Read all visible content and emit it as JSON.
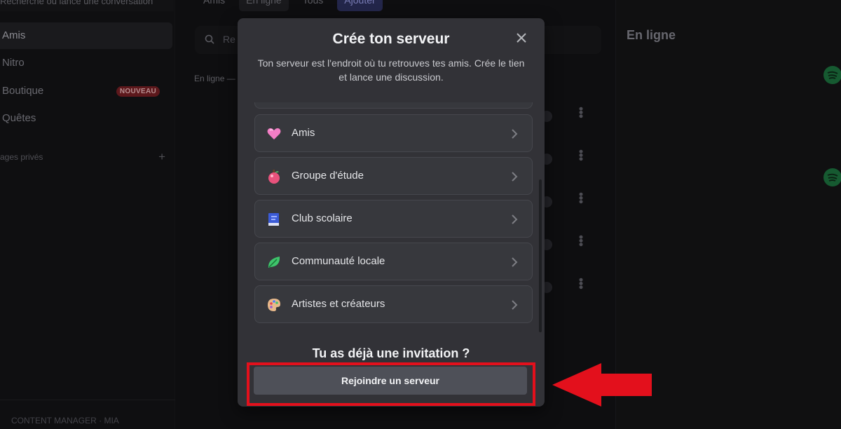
{
  "background": {
    "sidebar": {
      "search_text": "Recherche ou lance une conversation",
      "items": [
        {
          "label": "Amis",
          "active": true
        },
        {
          "label": "Nitro"
        },
        {
          "label": "Boutique",
          "badge": "NOUVEAU"
        },
        {
          "label": "Quêtes"
        }
      ],
      "dm_header": "ages privés",
      "dm_add": "+",
      "footer_text": "CONTENT MANAGER · MIA"
    },
    "tabs": [
      {
        "label": "Amis"
      },
      {
        "label": "En ligne",
        "selected": true
      },
      {
        "label": "Tous"
      },
      {
        "label": "Ajouter",
        "accent": true
      }
    ],
    "search_placeholder": "Re",
    "online_label": "En ligne —",
    "right_panel_title": "En ligne"
  },
  "modal": {
    "title": "Crée ton serveur",
    "subtitle": "Ton serveur est l'endroit où tu retrouves tes amis. Crée le tien et lance une discussion.",
    "options": [
      {
        "label": "Amis",
        "icon": "heart-icon"
      },
      {
        "label": "Groupe d'étude",
        "icon": "apple-icon"
      },
      {
        "label": "Club scolaire",
        "icon": "book-icon"
      },
      {
        "label": "Communauté locale",
        "icon": "leaf-icon"
      },
      {
        "label": "Artistes et créateurs",
        "icon": "palette-icon"
      }
    ],
    "invite_heading": "Tu as déjà une invitation ?",
    "join_button": "Rejoindre un serveur"
  },
  "colors": {
    "modal_bg": "#323237",
    "button_bg": "#4e5058",
    "highlight_red": "#e3101c",
    "badge_red": "#6e1d22"
  }
}
